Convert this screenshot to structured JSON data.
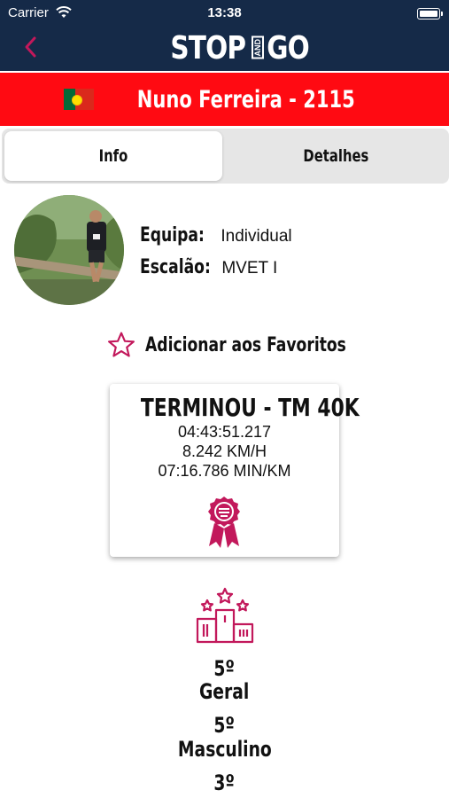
{
  "status_bar": {
    "carrier": "Carrier",
    "time": "13:38"
  },
  "header": {
    "logo_left": "STOP",
    "logo_mid": "AND",
    "logo_right": "GO"
  },
  "athlete": {
    "name": "Nuno Ferreira - 2115",
    "country_flag": "portugal-flag"
  },
  "tabs": [
    {
      "label": "Info",
      "active": true
    },
    {
      "label": "Detalhes",
      "active": false
    }
  ],
  "profile": {
    "team_label": "Equipa:",
    "team_value": "Individual",
    "class_label": "Escalão:",
    "class_value": "MVET I"
  },
  "favorites": {
    "label": "Adicionar aos Favoritos"
  },
  "result": {
    "title": "TERMINOU - TM 40K",
    "time": "04:43:51.217",
    "speed": "8.242 KM/H",
    "pace": "07:16.786 MIN/KM"
  },
  "rankings": [
    {
      "position": "5º",
      "category": "Geral"
    },
    {
      "position": "5º",
      "category": "Masculino"
    },
    {
      "position": "3º",
      "category": ""
    }
  ],
  "colors": {
    "header_bg": "#152a48",
    "name_bar": "#ff0a12",
    "accent": "#c2185b"
  }
}
